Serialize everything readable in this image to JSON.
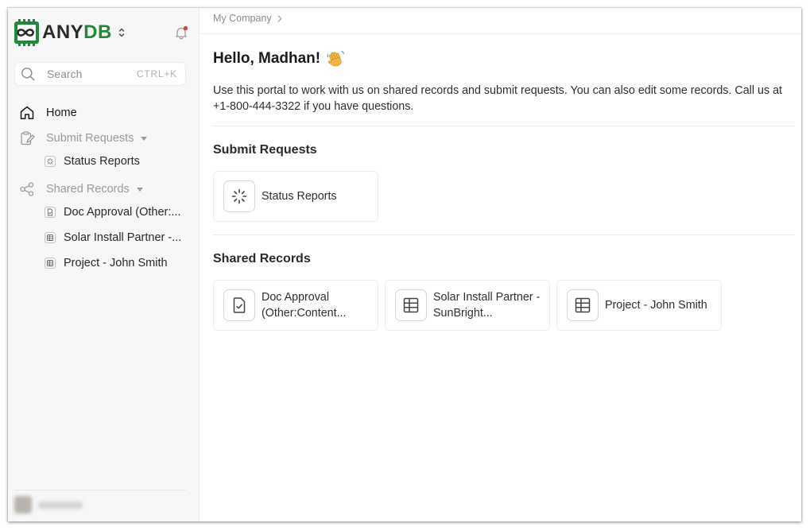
{
  "brand": {
    "name_part1": "ANY",
    "name_part2": "DB",
    "accent": "#1e8a3a"
  },
  "search": {
    "placeholder": "Search",
    "shortcut": "CTRL+K"
  },
  "sidebar": {
    "home": "Home",
    "submit_requests": {
      "label": "Submit Requests",
      "items": [
        "Status Reports"
      ]
    },
    "shared_records": {
      "label": "Shared Records",
      "items": [
        "Doc Approval (Other:...",
        "Solar Install Partner -...",
        "Project - John Smith"
      ]
    }
  },
  "breadcrumb": {
    "company": "My Company"
  },
  "main": {
    "greeting": "Hello, Madhan!",
    "intro": "Use this portal to work with us on shared records and submit requests. You can also edit some records. Call us at +1-800-444-3322 if you have questions.",
    "submit_requests": {
      "title": "Submit Requests",
      "cards": [
        {
          "label": "Status Reports",
          "icon": "loader-icon"
        }
      ]
    },
    "shared_records": {
      "title": "Shared Records",
      "cards": [
        {
          "label": "Doc Approval (Other:Content...",
          "icon": "file-check-icon"
        },
        {
          "label": "Solar Install Partner - SunBright...",
          "icon": "table-icon"
        },
        {
          "label": "Project - John Smith",
          "icon": "table-icon"
        }
      ]
    }
  },
  "colors": {
    "notification_dot": "#e53935",
    "muted_text": "#9a9a9a"
  }
}
